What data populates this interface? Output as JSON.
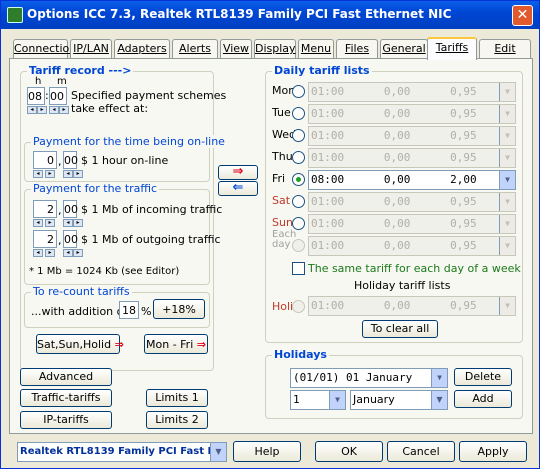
{
  "window": {
    "title": "Options ICC 7.3, Realtek RTL8139 Family PCI Fast Ethernet NIC",
    "close_glyph": "✕"
  },
  "tabs": [
    "Connection",
    "IP/LAN",
    "Adapters",
    "Alerts",
    "View",
    "Display",
    "Menu",
    "Files",
    "General",
    "Tariffs",
    "Edit"
  ],
  "active_tab": "Tariffs",
  "tariff_record": {
    "title": "Tariff record --->",
    "h_label": "h",
    "m_label": "m",
    "hours": "08",
    "minutes": "00",
    "text1": "Specified payment schemes",
    "text2": "take effect at:"
  },
  "online": {
    "title": "Payment for the time being on-line",
    "int": "0",
    "frac": "00",
    "label": "$ 1 hour on-line"
  },
  "traffic": {
    "title": "Payment for the traffic",
    "in_int": "2",
    "in_frac": "00",
    "in_label": "$ 1 Mb of incoming traffic",
    "out_int": "2",
    "out_frac": "00",
    "out_label": "$ 1 Mb of outgoing traffic",
    "note": "* 1 Mb = 1024 Kb (see Editor)"
  },
  "recount": {
    "title": "To re-count tariffs",
    "prefix": "...with addition of",
    "value": "18",
    "unit": "%",
    "button": "+18%"
  },
  "buttons": {
    "sat_sun_holid": "Sat,Sun,Holid",
    "mon_fri": "Mon - Fri",
    "advanced": "Advanced",
    "traffic_tariffs": "Traffic-tariffs",
    "ip_tariffs": "IP-tariffs",
    "limits1": "Limits 1",
    "limits2": "Limits 2",
    "copy_right": "⇒",
    "copy_left": "⇐"
  },
  "daily": {
    "title": "Daily tariff lists",
    "rows": [
      {
        "day": "Mon",
        "value": "01:00      0,00      0,95      0,95",
        "enabled": false,
        "checked": false,
        "style": "normal"
      },
      {
        "day": "Tue",
        "value": "01:00      0,00      0,95      0,95",
        "enabled": false,
        "checked": false,
        "style": "normal"
      },
      {
        "day": "Wed",
        "value": "01:00      0,00      0,95      0,95",
        "enabled": false,
        "checked": false,
        "style": "normal"
      },
      {
        "day": "Thu",
        "value": "01:00      0,00      0,95      0,95",
        "enabled": false,
        "checked": false,
        "style": "normal"
      },
      {
        "day": "Fri",
        "value": "08:00      0,00      2,00      2,00",
        "enabled": true,
        "checked": true,
        "style": "normal"
      },
      {
        "day": "Sat",
        "value": "01:00      0,00      0,95      0,95",
        "enabled": false,
        "checked": false,
        "style": "red"
      },
      {
        "day": "Sun",
        "value": "01:00      0,00      0,95      0,95",
        "enabled": false,
        "checked": false,
        "style": "red"
      },
      {
        "day": "Each\nday",
        "value": "01:00      0,00      0,95      0,95",
        "enabled": false,
        "checked": false,
        "style": "grey"
      }
    ],
    "same_tariff": "The same tariff for each day of a week",
    "holiday_lists": "Holiday tariff lists",
    "holid": {
      "day": "Holid",
      "value": "01:00      0,00      0,95      0,95"
    },
    "clear_all": "To clear all"
  },
  "holidays": {
    "title": "Holidays",
    "selected": "(01/01) 01 January",
    "day": "1",
    "month": "January",
    "delete": "Delete",
    "add": "Add"
  },
  "bottom": {
    "adapter": "Realtek RTL8139 Family PCI Fast Ether",
    "help": "Help",
    "ok": "OK",
    "cancel": "Cancel",
    "apply": "Apply"
  }
}
